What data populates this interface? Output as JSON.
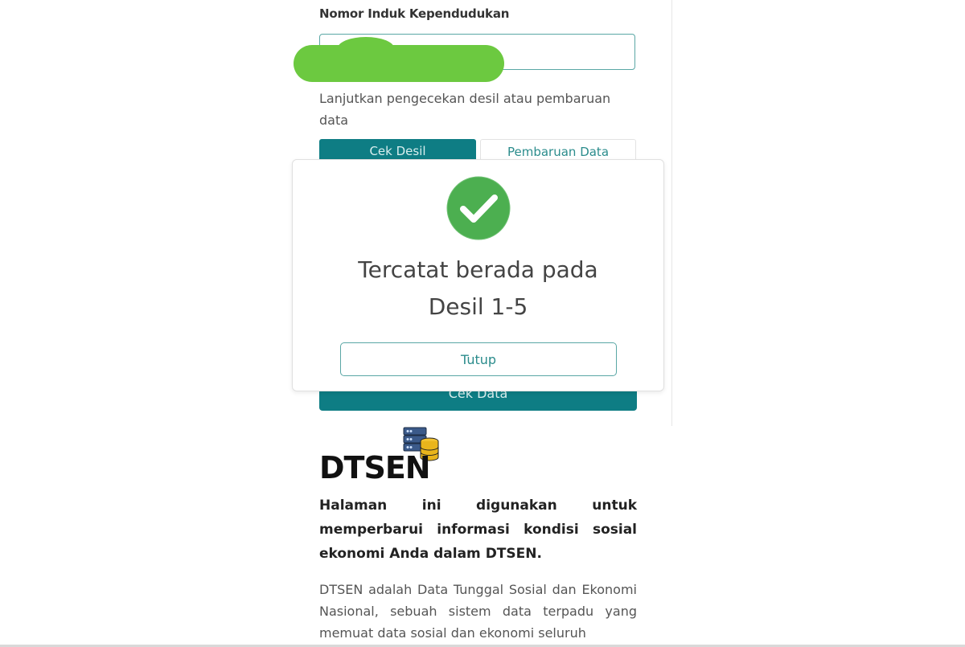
{
  "form": {
    "nik_label": "Nomor Induk Kependudukan",
    "nik_value": "",
    "instruction": "Lanjutkan pengecekan desil atau pembaruan data",
    "tabs": [
      {
        "label": "Cek Desil",
        "active": true
      },
      {
        "label": "Pembaruan Data",
        "active": false
      }
    ],
    "submit_label": "Cek Data"
  },
  "modal": {
    "icon": "check-circle-icon",
    "line1": "Tercatat berada pada",
    "line2": "Desil 1-5",
    "close_label": "Tutup"
  },
  "info": {
    "logo_text": "DTSEN",
    "logo_icon": "database-server-icon",
    "intro": "Halaman ini digunakan untuk memperbarui informasi kondisi sosial ekonomi Anda dalam DTSEN.",
    "description": "DTSEN adalah Data Tunggal Sosial dan Ekonomi Nasional, sebuah sistem data terpadu yang memuat data sosial dan ekonomi seluruh"
  },
  "colors": {
    "primary": "#0e7d84",
    "accent_border": "#5aa7a5",
    "success": "#4caf50",
    "redaction": "#6cc940"
  }
}
